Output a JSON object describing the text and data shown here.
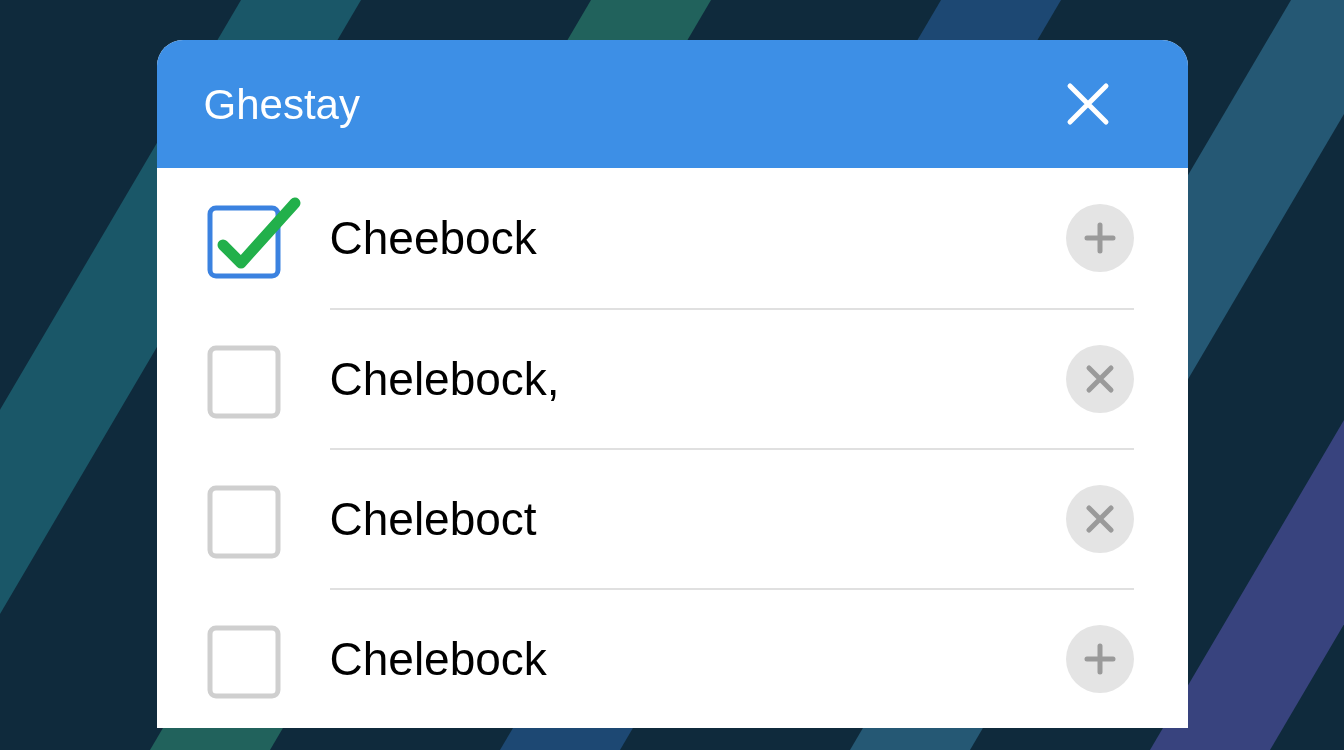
{
  "dialog": {
    "title": "Ghestay"
  },
  "items": [
    {
      "label": "Cheebock",
      "checked": true,
      "kind": "add"
    },
    {
      "label": "Chelebock,",
      "checked": false,
      "kind": "remove"
    },
    {
      "label": "Cheleboct",
      "checked": false,
      "kind": "remove"
    },
    {
      "label": "Chelebock",
      "checked": false,
      "kind": "add"
    }
  ]
}
